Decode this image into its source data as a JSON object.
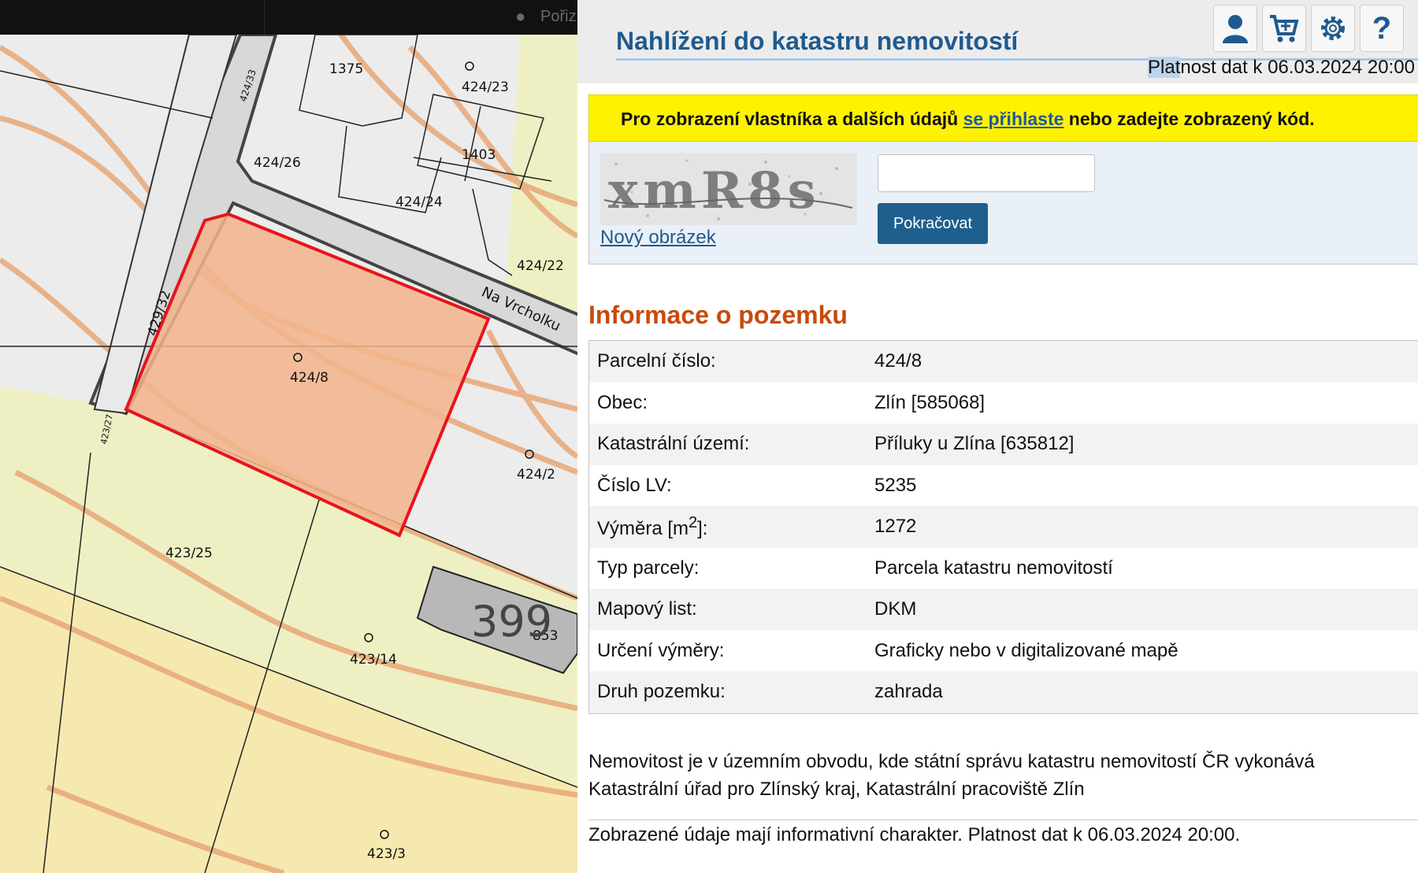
{
  "map": {
    "parcel_labels": [
      "1375",
      "424/23",
      "424/33",
      "424/26",
      "1403",
      "424/24",
      "424/22",
      "429/32",
      "424/8",
      "424/2",
      "423/27",
      "423/25",
      "423/14",
      "853",
      "423/3"
    ],
    "street_label": "Na Vrcholku",
    "house_number": "399",
    "highlighted_parcel": "424/8",
    "highlight_color": "#f3b48c"
  },
  "topbar": {
    "title_fragment": "Pořiz"
  },
  "app": {
    "title": "Nahlížení do katastru nemovitostí",
    "validity_prefix": "Plat",
    "validity_rest": "nost dat k 06.03.2024 20:00",
    "icons": [
      "user-icon",
      "cart-icon",
      "gear-icon",
      "help-icon"
    ]
  },
  "notice": {
    "before": "Pro zobrazení vlastníka a dalších údajů ",
    "link": "se přihlaste",
    "after": " nebo zadejte zobrazený kód."
  },
  "captcha": {
    "text": "xmR8s",
    "new_image_link": "Nový obrázek",
    "input_value": "",
    "continue_button": "Pokračovat"
  },
  "section_title": "Informace o pozemku",
  "info_rows": [
    {
      "label": "Parcelní číslo:",
      "value": "424/8"
    },
    {
      "label": "Obec:",
      "value": "Zlín [585068]"
    },
    {
      "label": "Katastrální území:",
      "value": "Příluky u Zlína [635812]"
    },
    {
      "label": "Číslo LV:",
      "value": "5235"
    },
    {
      "label": "Výměra [m",
      "sup": "2",
      "label_tail": "]:",
      "value": "1272"
    },
    {
      "label": "Typ parcely:",
      "value": "Parcela katastru nemovitostí"
    },
    {
      "label": "Mapový list:",
      "value": "DKM"
    },
    {
      "label": "Určení výměry:",
      "value": "Graficky nebo v digitalizované mapě"
    },
    {
      "label": "Druh pozemku:",
      "value": "zahrada"
    }
  ],
  "footnote_line1": "Nemovitost je v územním obvodu, kde státní správu katastru nemovitostí ČR vykonává",
  "footnote_line2": "Katastrální úřad pro Zlínský kraj, Katastrální pracoviště Zlín",
  "disclaimer": "Zobrazené údaje mají informativní charakter. Platnost dat k 06.03.2024 20:00.",
  "colors": {
    "title_blue": "#1f5a8e",
    "section_orange": "#c84a0c",
    "notice_yellow": "#fff200",
    "button_blue": "#1f5f8e"
  }
}
